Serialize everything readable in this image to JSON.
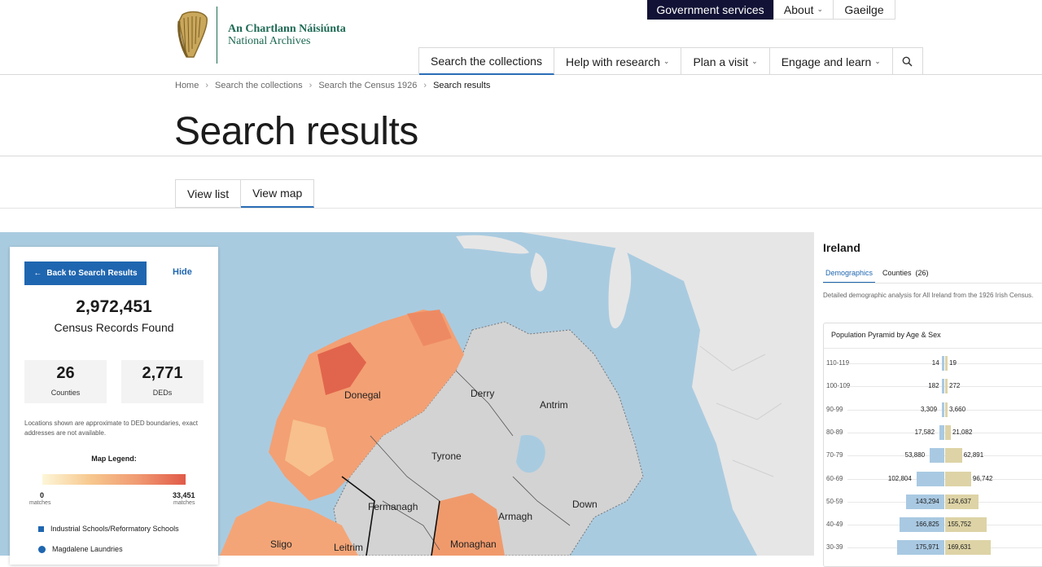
{
  "header": {
    "logo_irish": "An Chartlann Náisiúnta",
    "logo_english": "National Archives",
    "utility_nav": [
      {
        "label": "Government services"
      },
      {
        "label": "About"
      },
      {
        "label": "Gaeilge"
      }
    ],
    "main_nav": [
      {
        "label": "Search the collections"
      },
      {
        "label": "Help with research"
      },
      {
        "label": "Plan a visit"
      },
      {
        "label": "Engage and learn"
      }
    ]
  },
  "breadcrumb": [
    "Home",
    "Search the collections",
    "Search the Census 1926",
    "Search results"
  ],
  "page_title": "Search results",
  "view_tabs": [
    "View list",
    "View map"
  ],
  "map": {
    "labels": [
      "Donegal",
      "Derry",
      "Antrim",
      "Tyrone",
      "Fermanagh",
      "Armagh",
      "Down",
      "Sligo",
      "Leitrim",
      "Monaghan"
    ]
  },
  "left_panel": {
    "back_button": "Back to Search Results",
    "hide_link": "Hide",
    "records_count": "2,972,451",
    "records_label": "Census Records Found",
    "stats": [
      {
        "value": "26",
        "label": "Counties"
      },
      {
        "value": "2,771",
        "label": "DEDs"
      }
    ],
    "note": "Locations shown are approximate to DED boundaries, exact addresses are not available.",
    "legend": {
      "title": "Map Legend:",
      "min_value": "0",
      "max_value": "33,451",
      "unit": "matches",
      "items": [
        {
          "label": "Industrial Schools/Reformatory Schools",
          "icon": "square-marker-icon"
        },
        {
          "label": "Magdalene Laundries",
          "icon": "circle-marker-icon"
        }
      ]
    }
  },
  "right_panel": {
    "title": "Ireland",
    "tabs": [
      "Demographics",
      "Counties  (26)"
    ],
    "description": "Detailed demographic analysis for All Ireland from the 1926 Irish Census.",
    "pyramid_title": "Population Pyramid by Age & Sex"
  },
  "chart_data": {
    "type": "bar",
    "title": "Population Pyramid by Age & Sex",
    "categories": [
      "110-119",
      "100-109",
      "90-99",
      "80-89",
      "70-79",
      "60-69",
      "50-59",
      "40-49",
      "30-39"
    ],
    "series": [
      {
        "values": [
          14,
          182,
          3309,
          17582,
          53880,
          102804,
          143294,
          166825,
          175971
        ],
        "labels": [
          "14",
          "182",
          "3,309",
          "17,582",
          "53,880",
          "102,804",
          "143,294",
          "166,825",
          "175,971"
        ]
      },
      {
        "values": [
          19,
          272,
          3660,
          21082,
          62891,
          96742,
          124637,
          155752,
          169631
        ],
        "labels": [
          "19",
          "272",
          "3,660",
          "21,082",
          "62,891",
          "96,742",
          "124,637",
          "155,752",
          "169,631"
        ]
      }
    ],
    "colors": {
      "male": "#a9c9e2",
      "female": "#ddd3a6"
    }
  },
  "colors": {
    "brand_green": "#1e6a54",
    "navy": "#121236",
    "accent_blue": "#1f66b0",
    "sea": "#a9cbe0"
  }
}
